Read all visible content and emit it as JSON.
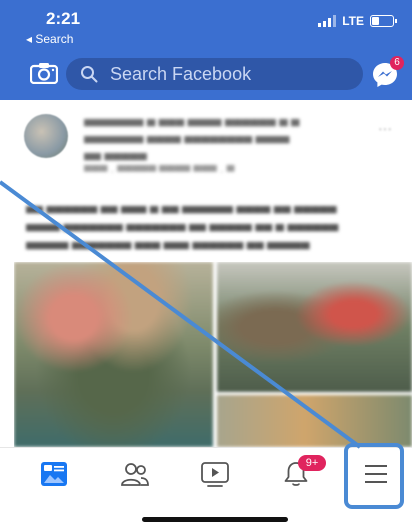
{
  "status_bar": {
    "time": "2:21",
    "back_label": "◂ Search",
    "network": "LTE"
  },
  "header": {
    "search_placeholder": "Search Facebook",
    "messenger_badge": "6",
    "accent_color": "#3b6fd0"
  },
  "post": {
    "dots": "···"
  },
  "tabbar": {
    "notifications_badge": "9+",
    "highlight_color": "#4a8ad4"
  },
  "icons": [
    "camera-icon",
    "search-icon",
    "messenger-icon",
    "news-feed-icon",
    "friends-icon",
    "watch-icon",
    "bell-icon",
    "menu-icon"
  ]
}
